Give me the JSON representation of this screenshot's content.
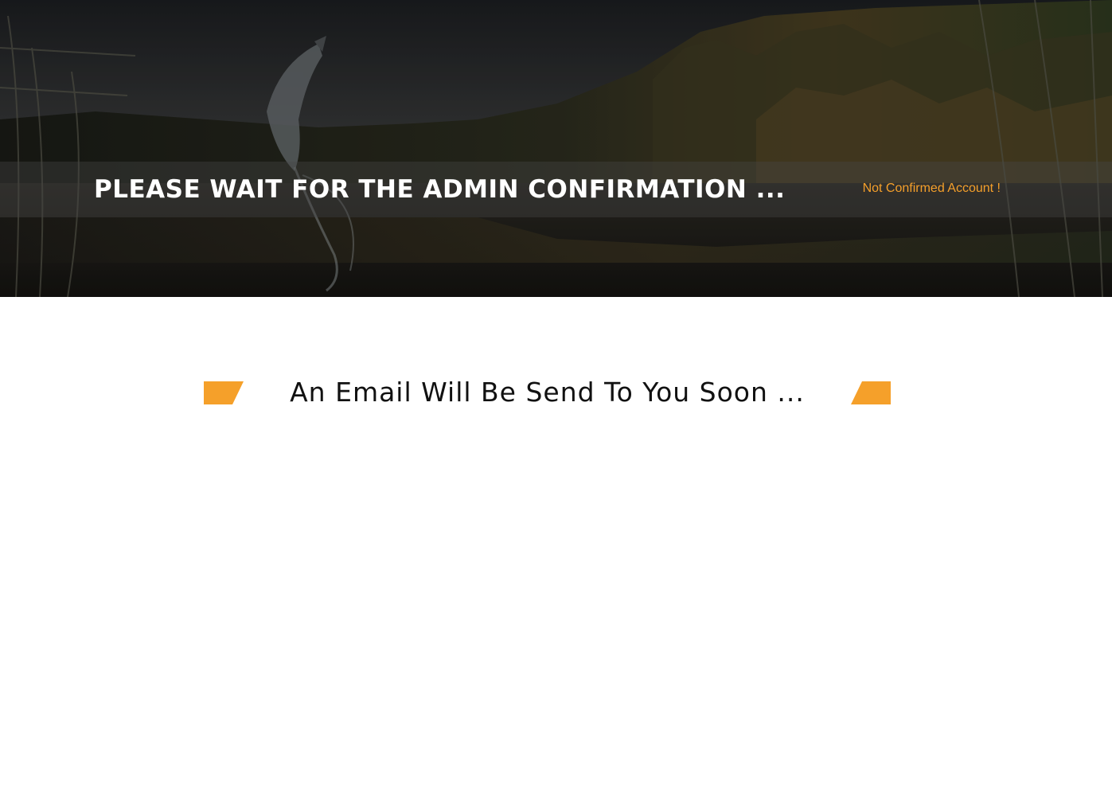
{
  "banner": {
    "title": "PLEASE WAIT FOR THE ADMIN CONFIRMATION ...",
    "status": "Not Confirmed Account !"
  },
  "message": {
    "text": "An Email Will Be Send To You Soon ..."
  },
  "colors": {
    "accent": "#f5a02a",
    "heading": "#111111",
    "banner_text": "#ffffff"
  }
}
